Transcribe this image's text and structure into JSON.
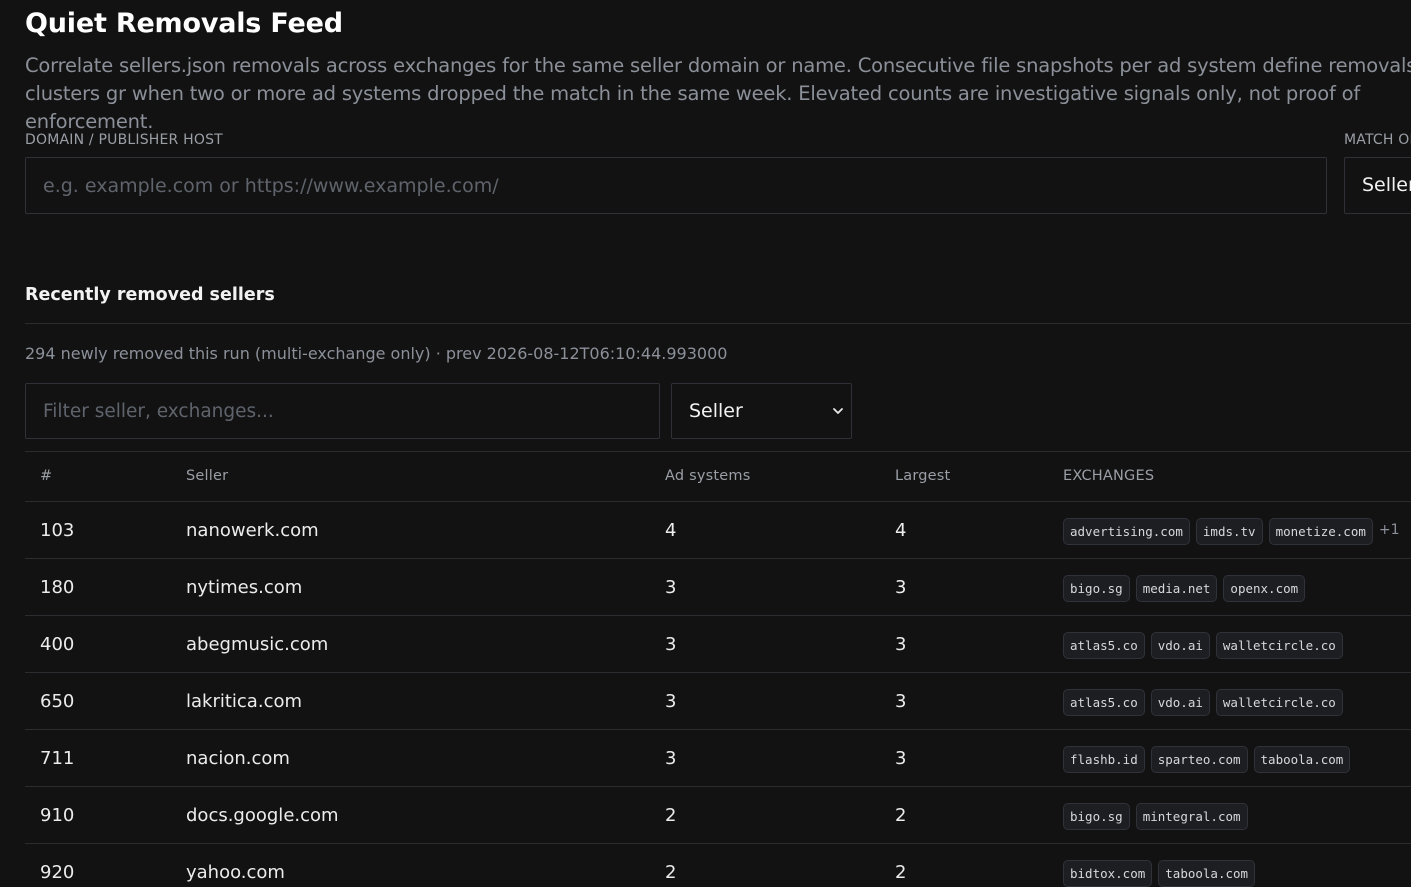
{
  "header": {
    "title": "Quiet Removals Feed",
    "description": "Correlate sellers.json removals across exchanges for the same seller domain or name. Consecutive file snapshots per ad system define removals; clusters gr when two or more ad systems dropped the match in the same week. Elevated counts are investigative signals only, not proof of enforcement."
  },
  "search": {
    "domain_label": "DOMAIN / PUBLISHER HOST",
    "domain_placeholder": "e.g. example.com or https://www.example.com/",
    "domain_value": "",
    "match_label": "MATCH OI",
    "match_value": "Seller"
  },
  "feed": {
    "section_title": "Recently removed sellers",
    "summary": "294 newly removed this run (multi-exchange only) · prev 2026-08-12T06:10:44.993000",
    "filter_placeholder": "Filter seller, exchanges...",
    "sort_value": "Seller",
    "columns": [
      "#",
      "Seller",
      "Ad systems",
      "Largest",
      "EXCHANGES"
    ],
    "rows": [
      {
        "num": "103",
        "seller": "nanowerk.com",
        "ad_systems": "4",
        "largest": "4",
        "exchanges": [
          "advertising.com",
          "imds.tv",
          "monetize.com"
        ],
        "more": "+1"
      },
      {
        "num": "180",
        "seller": "nytimes.com",
        "ad_systems": "3",
        "largest": "3",
        "exchanges": [
          "bigo.sg",
          "media.net",
          "openx.com"
        ],
        "more": ""
      },
      {
        "num": "400",
        "seller": "abegmusic.com",
        "ad_systems": "3",
        "largest": "3",
        "exchanges": [
          "atlas5.co",
          "vdo.ai",
          "walletcircle.co"
        ],
        "more": ""
      },
      {
        "num": "650",
        "seller": "lakritica.com",
        "ad_systems": "3",
        "largest": "3",
        "exchanges": [
          "atlas5.co",
          "vdo.ai",
          "walletcircle.co"
        ],
        "more": ""
      },
      {
        "num": "711",
        "seller": "nacion.com",
        "ad_systems": "3",
        "largest": "3",
        "exchanges": [
          "flashb.id",
          "sparteo.com",
          "taboola.com"
        ],
        "more": ""
      },
      {
        "num": "910",
        "seller": "docs.google.com",
        "ad_systems": "2",
        "largest": "2",
        "exchanges": [
          "bigo.sg",
          "mintegral.com"
        ],
        "more": ""
      },
      {
        "num": "920",
        "seller": "yahoo.com",
        "ad_systems": "2",
        "largest": "2",
        "exchanges": [
          "bidtox.com",
          "taboola.com"
        ],
        "more": ""
      }
    ]
  },
  "icons": {
    "select_chevron": "chevron-down-icon"
  },
  "colors": {
    "background": "#121212",
    "border": "#2f3136",
    "muted_text": "#8b9099",
    "chip_background": "#1c1e22"
  }
}
